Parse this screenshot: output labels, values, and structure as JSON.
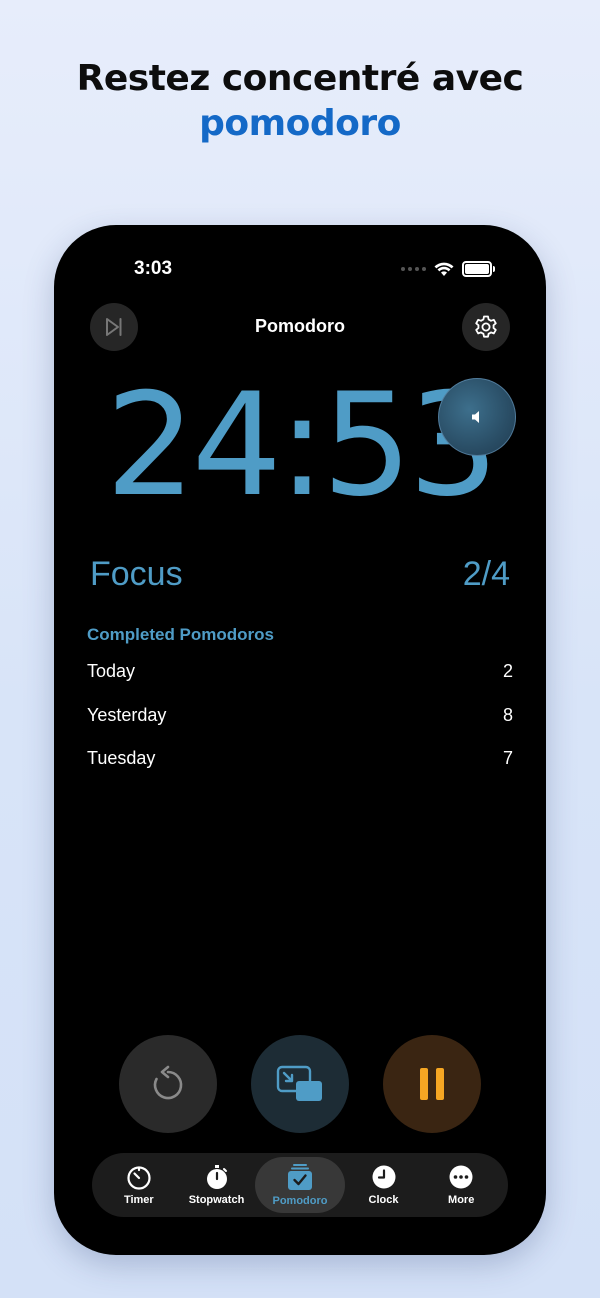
{
  "headline": {
    "line1": "Restez concentré avec",
    "line2": "pomodoro"
  },
  "status_bar": {
    "time": "3:03"
  },
  "nav": {
    "title": "Pomodoro"
  },
  "timer": {
    "display": "24:53"
  },
  "session": {
    "label": "Focus",
    "progress": "2/4"
  },
  "completed": {
    "title": "Completed Pomodoros",
    "rows": [
      {
        "day": "Today",
        "count": "2"
      },
      {
        "day": "Yesterday",
        "count": "8"
      },
      {
        "day": "Tuesday",
        "count": "7"
      }
    ]
  },
  "tabs": [
    {
      "label": "Timer",
      "icon": "timer-icon"
    },
    {
      "label": "Stopwatch",
      "icon": "stopwatch-icon"
    },
    {
      "label": "Pomodoro",
      "icon": "pomodoro-icon",
      "active": true
    },
    {
      "label": "Clock",
      "icon": "clock-icon"
    },
    {
      "label": "More",
      "icon": "more-icon"
    }
  ],
  "colors": {
    "accent": "#4f9cc6",
    "headline_accent": "#1469c7",
    "pause_accent": "#f5a623"
  }
}
